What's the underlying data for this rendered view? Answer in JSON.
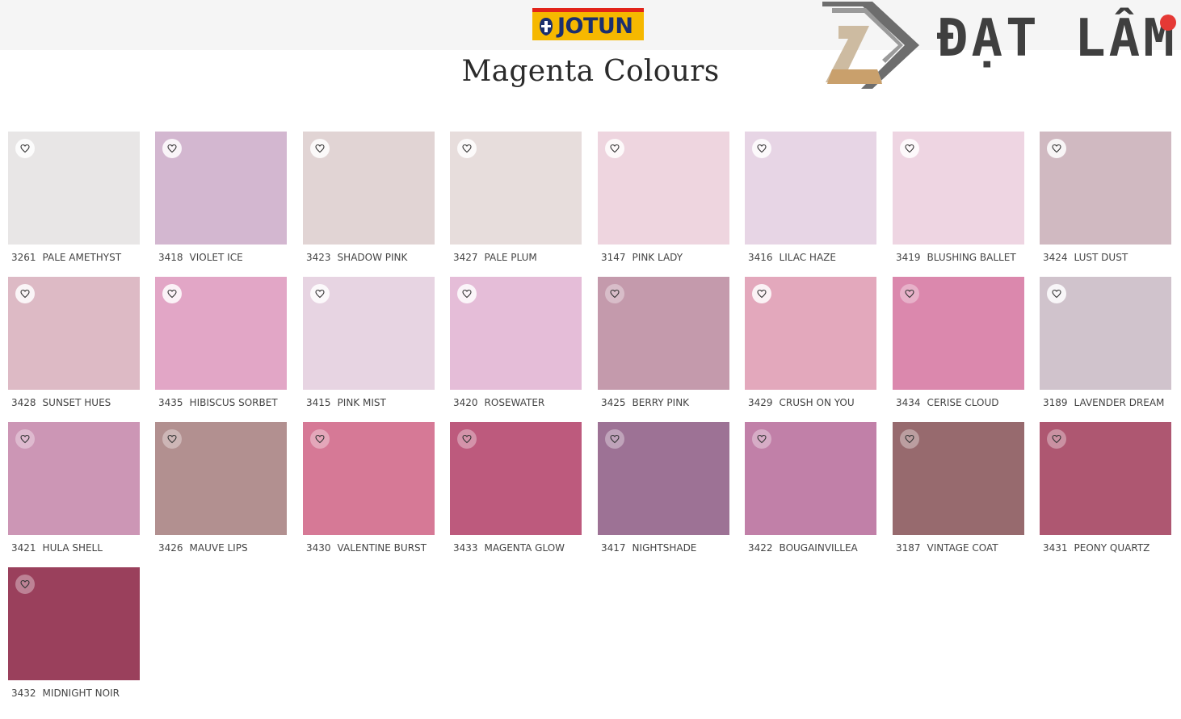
{
  "header": {
    "brand": "JOTUN",
    "title": "Magenta Colours",
    "watermark": "ĐẠT LÂM"
  },
  "colors": {
    "brand_red": "#e2231a",
    "brand_yellow": "#f6b800",
    "brand_blue": "#1b2f6e"
  },
  "swatches": [
    {
      "code": "3261",
      "name": "PALE AMETHYST",
      "color": "#e8e6e6"
    },
    {
      "code": "3418",
      "name": "VIOLET ICE",
      "color": "#d3b7d0"
    },
    {
      "code": "3423",
      "name": "SHADOW PINK",
      "color": "#e1d4d4"
    },
    {
      "code": "3427",
      "name": "PALE PLUM",
      "color": "#e7dddc"
    },
    {
      "code": "3147",
      "name": "PINK LADY",
      "color": "#eed5df"
    },
    {
      "code": "3416",
      "name": "LILAC HAZE",
      "color": "#e7d5e5"
    },
    {
      "code": "3419",
      "name": "BLUSHING BALLET",
      "color": "#eed5e2"
    },
    {
      "code": "3424",
      "name": "LUST DUST",
      "color": "#d0b9c1"
    },
    {
      "code": "3428",
      "name": "SUNSET HUES",
      "color": "#ddbac5"
    },
    {
      "code": "3435",
      "name": "HIBISCUS SORBET",
      "color": "#e2a6c6"
    },
    {
      "code": "3415",
      "name": "PINK MIST",
      "color": "#e7d4e2"
    },
    {
      "code": "3420",
      "name": "ROSEWATER",
      "color": "#e5bdd8"
    },
    {
      "code": "3425",
      "name": "BERRY PINK",
      "color": "#c49aac"
    },
    {
      "code": "3429",
      "name": "CRUSH ON YOU",
      "color": "#e3a8bc"
    },
    {
      "code": "3434",
      "name": "CERISE CLOUD",
      "color": "#db88ad"
    },
    {
      "code": "3189",
      "name": "LAVENDER DREAM",
      "color": "#d0c3cc"
    },
    {
      "code": "3421",
      "name": "HULA SHELL",
      "color": "#cc96b5"
    },
    {
      "code": "3426",
      "name": "MAUVE LIPS",
      "color": "#b29090"
    },
    {
      "code": "3430",
      "name": "VALENTINE BURST",
      "color": "#d67996"
    },
    {
      "code": "3433",
      "name": "MAGENTA GLOW",
      "color": "#bd5a7d"
    },
    {
      "code": "3417",
      "name": "NIGHTSHADE",
      "color": "#9d7295"
    },
    {
      "code": "3422",
      "name": "BOUGAINVILLEA",
      "color": "#c180a8"
    },
    {
      "code": "3187",
      "name": "VINTAGE COAT",
      "color": "#976a6e"
    },
    {
      "code": "3431",
      "name": "PEONY QUARTZ",
      "color": "#ae5771"
    },
    {
      "code": "3432",
      "name": "MIDNIGHT NOIR",
      "color": "#9a405c"
    }
  ]
}
